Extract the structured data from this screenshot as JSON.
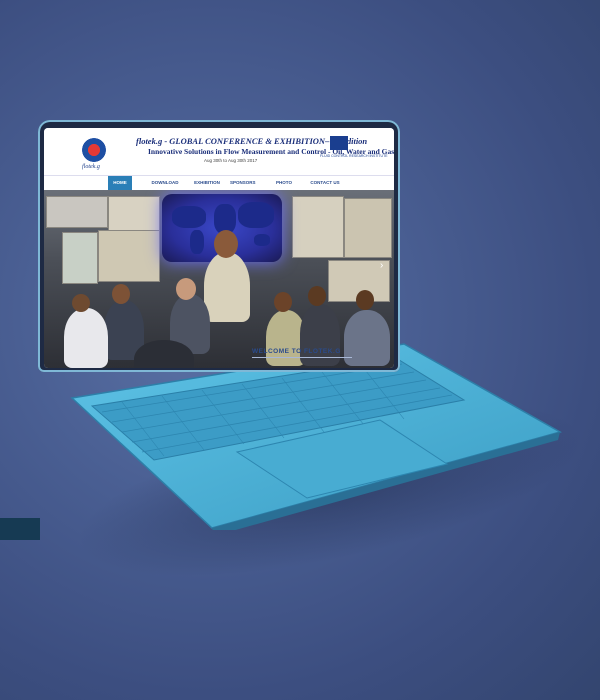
{
  "site": {
    "logo_text": "flotek.g",
    "title": "flotek.g - GLOBAL CONFERENCE & EXHIBITION- 1st Edition",
    "title_prefix": "flotek.g - GLOBAL CONFERENCE & EXHIBITION– 1",
    "title_sup": "st",
    "title_suffix": " Edition",
    "subtitle": "Innovative Solutions in Flow Measurement and Control - Oil, Water and Gas",
    "date": "Aug 30th to Aug 30th 2017",
    "partner_text": "FLUID CONTROL RESEARCH INSTITUTE"
  },
  "nav": {
    "items": [
      "HOME",
      "DOWNLOAD PAPERS",
      "EXHIBITION",
      "SPONSORS",
      "PHOTO GALLERY",
      "CONTACT US"
    ],
    "active_index": 0
  },
  "hero": {
    "next_icon": "chevron-right-icon"
  },
  "welcome": {
    "heading": "WELCOME TO FLOTEK.G"
  },
  "colors": {
    "background": "#4a5f93",
    "laptop_body": "#4fb0d6",
    "nav_active": "#2a7fb7",
    "title_blue": "#1b2f7a"
  }
}
